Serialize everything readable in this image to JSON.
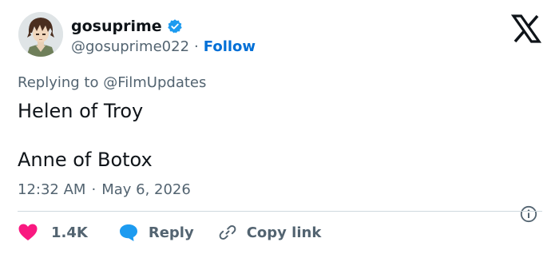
{
  "user": {
    "display_name": "gosuprime",
    "handle": "@gosuprime022",
    "separator": "·",
    "follow_label": "Follow",
    "verified": true
  },
  "reply_context": {
    "prefix": "Replying to",
    "mention": "@FilmUpdates"
  },
  "tweet": {
    "lines": [
      "Helen of Troy",
      "Anne of Botox"
    ]
  },
  "meta": {
    "time": "12:32 AM",
    "separator": "·",
    "date": "May 6, 2026"
  },
  "actions": {
    "like_count": "1.4K",
    "reply_label": "Reply",
    "copy_label": "Copy link"
  },
  "icons": {
    "logo": "x-logo-icon",
    "verified": "verified-badge-icon",
    "info": "info-icon",
    "like": "heart-icon",
    "reply": "speech-bubble-icon",
    "copy": "link-icon"
  },
  "colors": {
    "accent": "#006fd6",
    "verified": "#1d9bf0",
    "like": "#f91880",
    "reply": "#1d9bf0",
    "text": "#0f1419",
    "muted": "#536471",
    "divider": "#cfd9de"
  }
}
